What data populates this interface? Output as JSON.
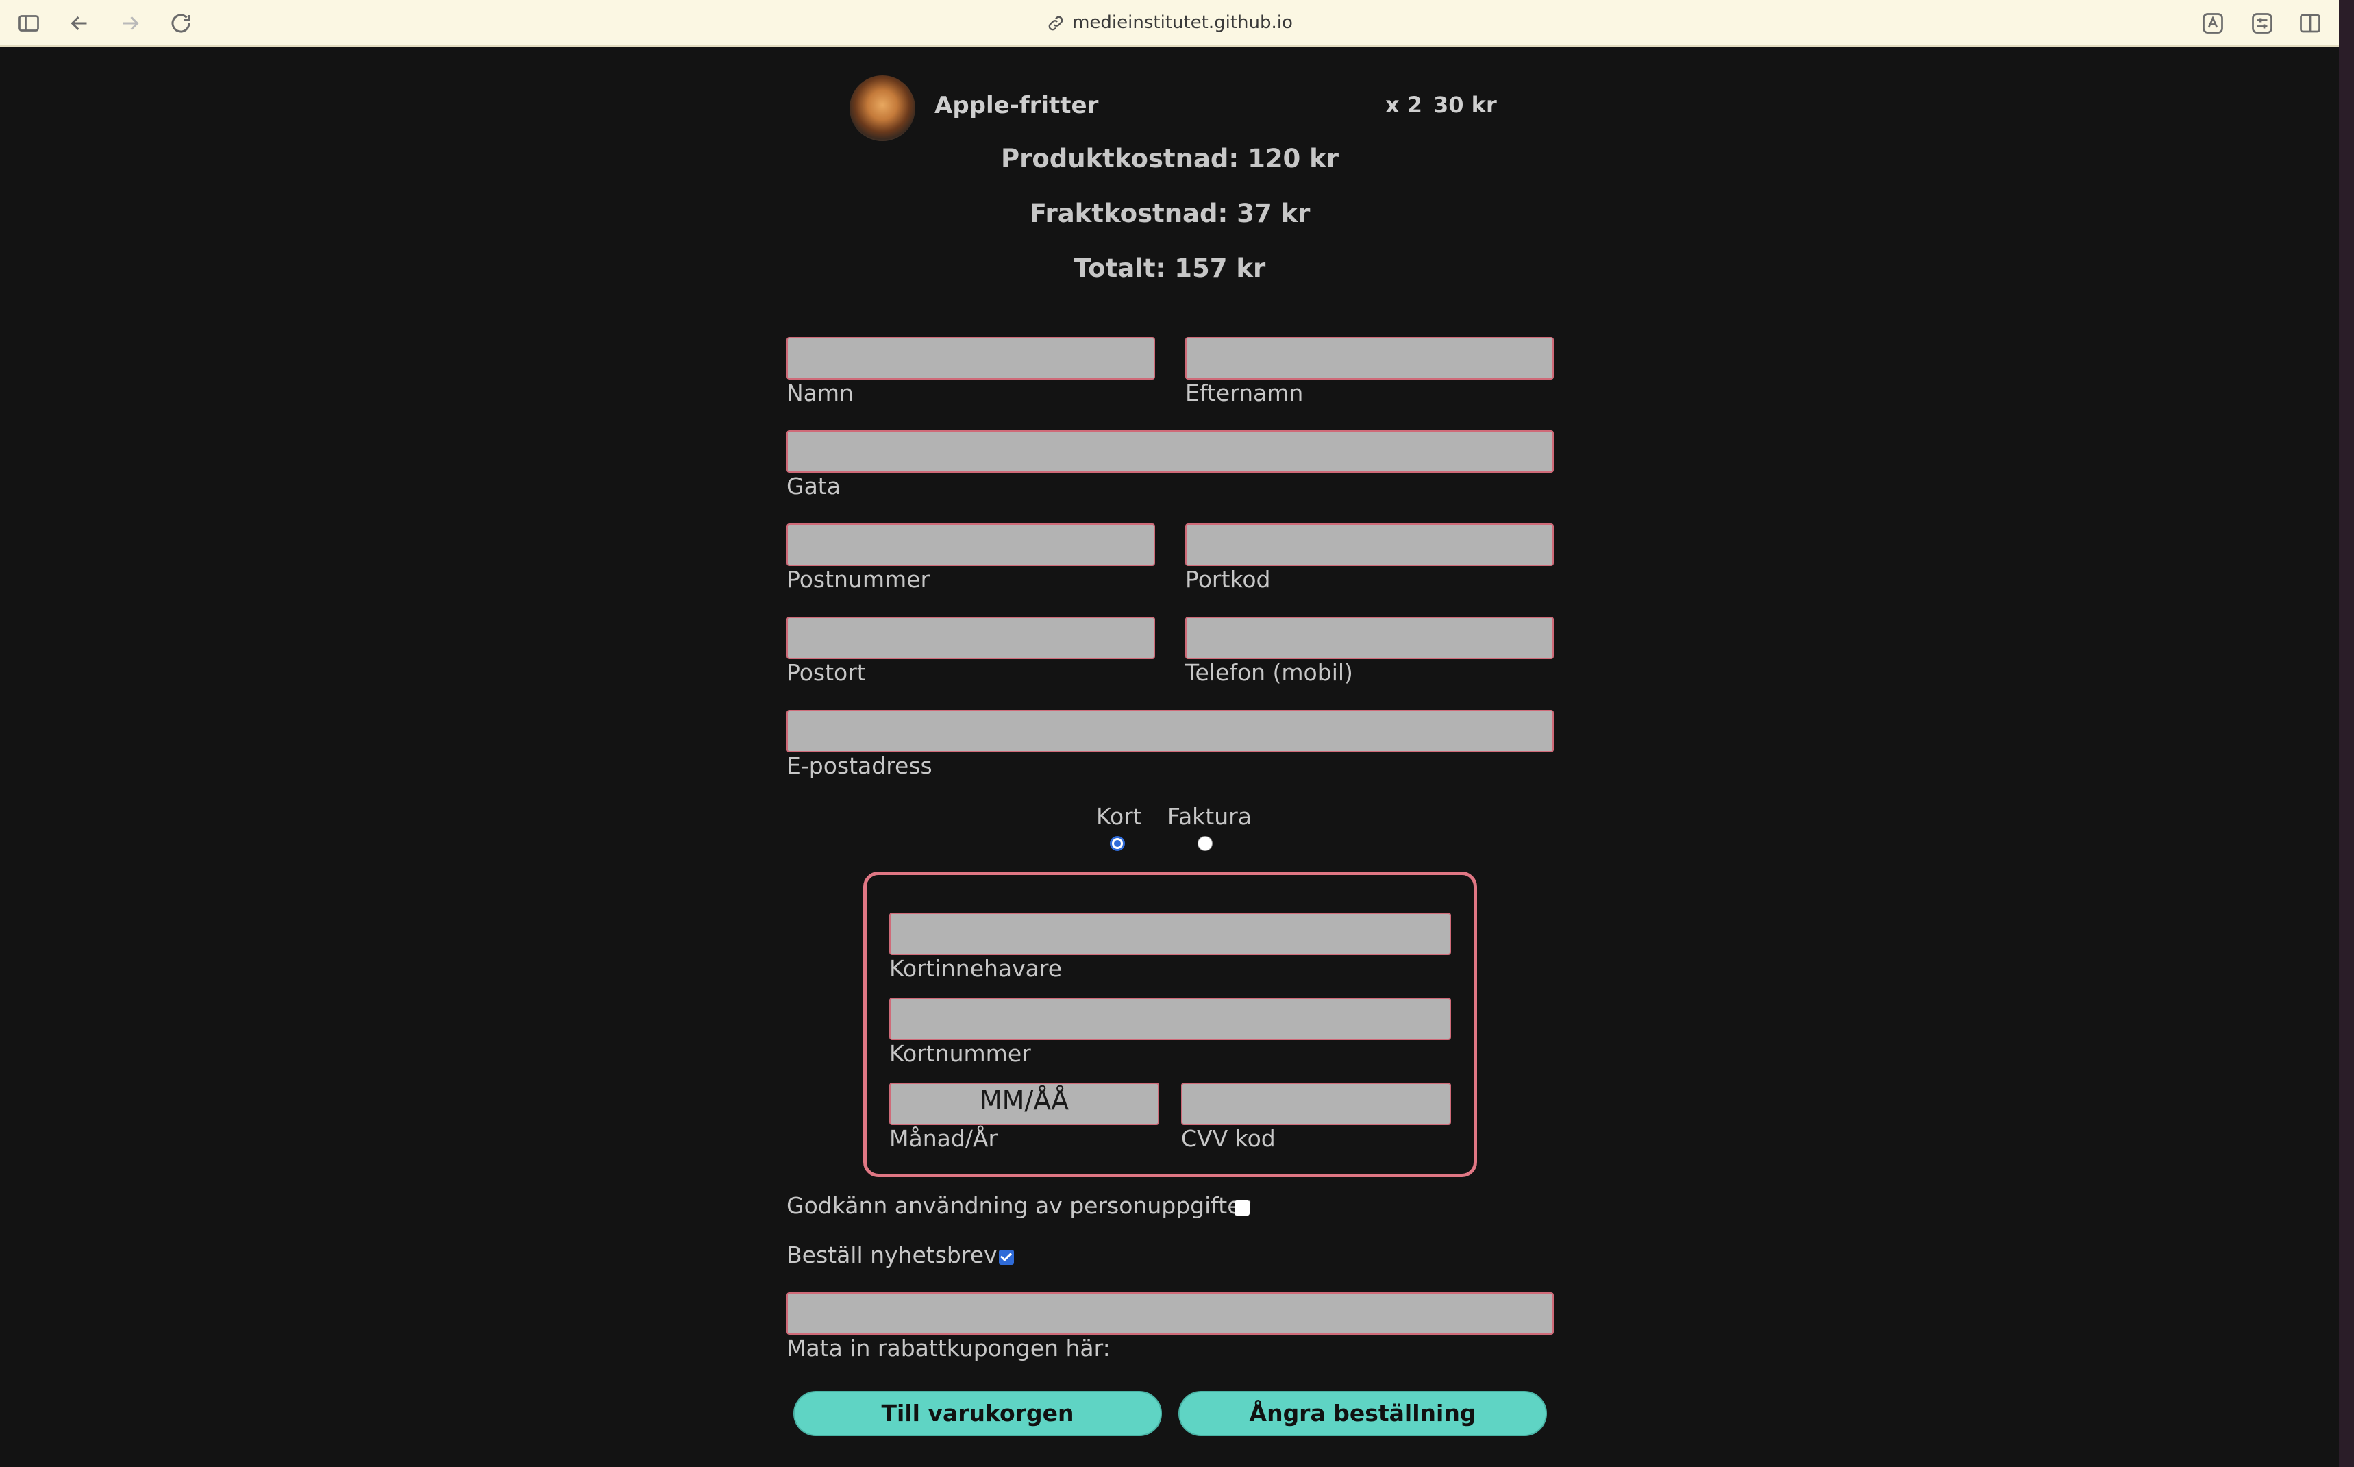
{
  "browser": {
    "url": "medieinstitutet.github.io",
    "sidebar_icon": "sidebar-icon",
    "back_icon": "back-arrow-icon",
    "forward_icon": "forward-arrow-icon",
    "reload_icon": "reload-icon",
    "translate_icon": "translate-icon",
    "extension_icon": "extension-icon",
    "split_view_icon": "split-view-icon"
  },
  "cart": {
    "item": {
      "name": "Apple-fritter",
      "qty": "x 2",
      "price": "30 kr"
    },
    "product_cost": "Produktkostnad: 120 kr",
    "shipping_cost": "Fraktkostnad: 37 kr",
    "total": "Totalt: 157 kr"
  },
  "form": {
    "first_name_label": "Namn",
    "last_name_label": "Efternamn",
    "street_label": "Gata",
    "postal_code_label": "Postnummer",
    "door_code_label": "Portkod",
    "city_label": "Postort",
    "phone_label": "Telefon (mobil)",
    "email_label": "E-postadress",
    "first_name_value": "",
    "last_name_value": "",
    "street_value": "",
    "postal_code_value": "",
    "door_code_value": "",
    "city_value": "",
    "phone_value": "",
    "email_value": ""
  },
  "payment": {
    "card_label": "Kort",
    "invoice_label": "Faktura",
    "selected": "Kort",
    "card_holder_label": "Kortinnehavare",
    "card_number_label": "Kortnummer",
    "expiry_label": "Månad/År",
    "expiry_placeholder": "MM/ÅÅ",
    "cvv_label": "CVV kod"
  },
  "consent": {
    "personal_data_label": "Godkänn användning av personuppgifter",
    "personal_data_checked": false,
    "newsletter_label": "Beställ nyhetsbrev",
    "newsletter_checked": true
  },
  "coupon": {
    "label": "Mata in rabattkupongen här:",
    "value": ""
  },
  "buttons": {
    "to_cart": "Till varukorgen",
    "cancel_order": "Ångra beställning"
  },
  "colors": {
    "page_bg": "#131313",
    "field_bg": "#b3b3b3",
    "field_border": "#cf6a78",
    "accent_button": "#5fd4c4",
    "card_box_border": "#e07784",
    "radio_checked": "#2f6bd8"
  }
}
